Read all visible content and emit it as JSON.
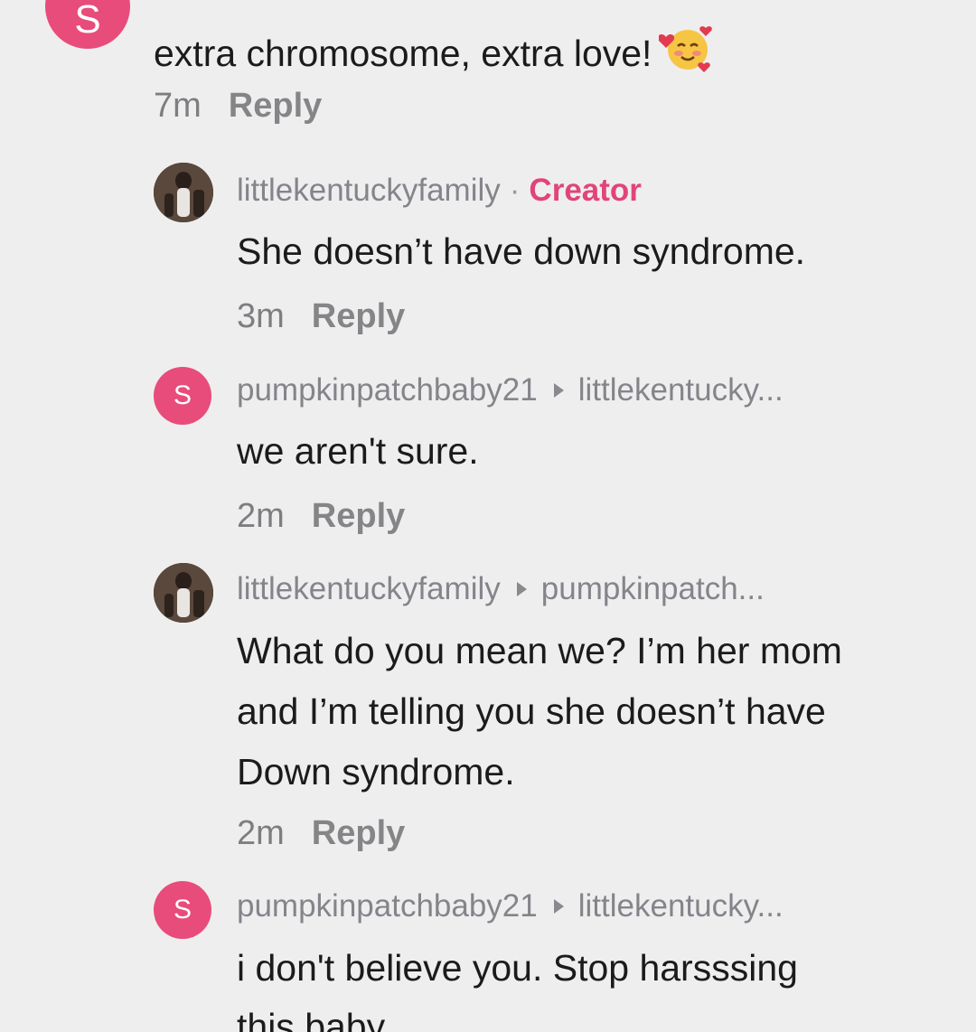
{
  "colors": {
    "background": "#efeeef",
    "accent_pink": "#e84c7b",
    "creator_label": "#e0457a",
    "text": "#1b1b1b",
    "meta_text": "#858487"
  },
  "comments": [
    {
      "avatar_letter": "S",
      "text": "extra chromosome, extra love!",
      "emoji": "smiling-face-with-hearts-icon",
      "time": "7m",
      "reply_label": "Reply"
    },
    {
      "username": "littlekentuckyfamily",
      "separator": "·",
      "badge": "Creator",
      "lines": [
        "She doesn’t have down syndrome."
      ],
      "time": "3m",
      "reply_label": "Reply"
    },
    {
      "avatar_letter": "S",
      "username": "pumpkinpatchbaby21",
      "reply_to": "littlekentucky...",
      "lines": [
        "we aren't sure."
      ],
      "time": "2m",
      "reply_label": "Reply"
    },
    {
      "username": "littlekentuckyfamily",
      "reply_to": "pumpkinpatch...",
      "lines": [
        "What do you mean we? I’m her mom",
        "and I’m telling you she doesn’t have",
        "Down syndrome."
      ],
      "time": "2m",
      "reply_label": "Reply"
    },
    {
      "avatar_letter": "S",
      "username": "pumpkinpatchbaby21",
      "reply_to": "littlekentucky...",
      "lines": [
        "i don't believe you. Stop harsssing",
        "this baby"
      ]
    }
  ]
}
